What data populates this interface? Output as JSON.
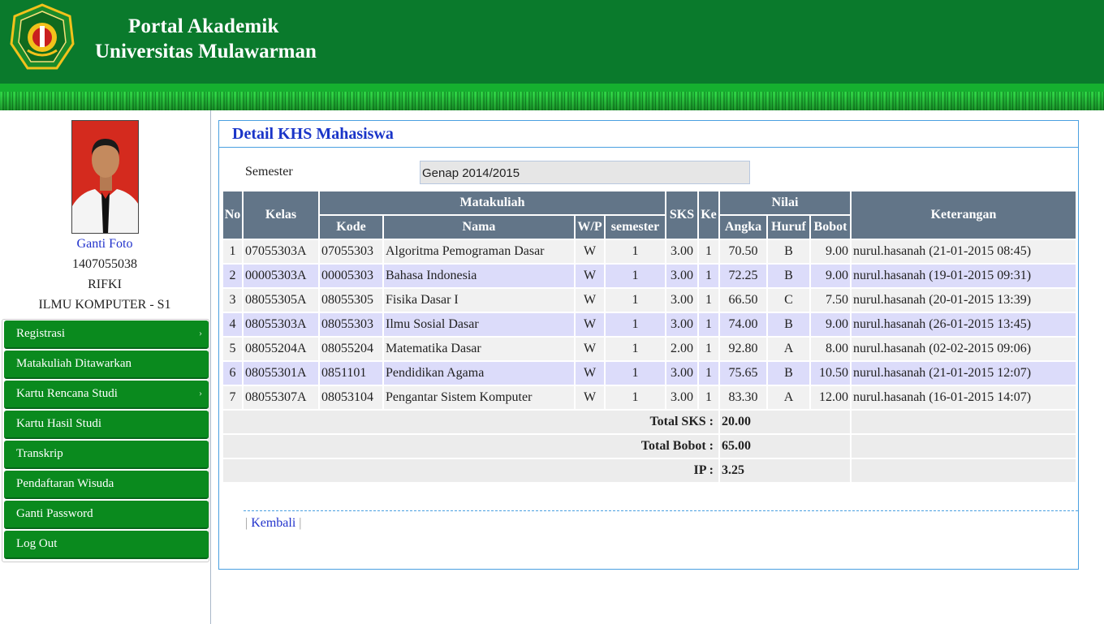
{
  "header": {
    "title_line1": "Portal Akademik",
    "title_line2": "Universitas Mulawarman"
  },
  "profile": {
    "change_photo_link": "Ganti Foto",
    "nim": "1407055038",
    "name": "RIFKI",
    "program": "ILMU KOMPUTER - S1"
  },
  "menu": [
    {
      "label": "Registrasi",
      "has_submenu": true
    },
    {
      "label": "Matakuliah Ditawarkan",
      "has_submenu": false
    },
    {
      "label": "Kartu Rencana Studi",
      "has_submenu": true
    },
    {
      "label": "Kartu Hasil Studi",
      "has_submenu": false
    },
    {
      "label": "Transkrip",
      "has_submenu": false
    },
    {
      "label": "Pendaftaran Wisuda",
      "has_submenu": false
    },
    {
      "label": "Ganti Password",
      "has_submenu": false
    },
    {
      "label": "Log Out",
      "has_submenu": false
    }
  ],
  "page": {
    "title": "Detail KHS Mahasiswa",
    "semester_label": "Semester",
    "semester_value": "Genap 2014/2015"
  },
  "table": {
    "headers": {
      "no": "No",
      "kelas": "Kelas",
      "matakuliah": "Matakuliah",
      "sks": "SKS",
      "ke": "Ke",
      "nilai": "Nilai",
      "keterangan": "Keterangan",
      "kode": "Kode",
      "nama": "Nama",
      "wp": "W/P",
      "semester": "semester",
      "angka": "Angka",
      "huruf": "Huruf",
      "bobot": "Bobot"
    },
    "rows": [
      {
        "no": "1",
        "kelas": "07055303A",
        "kode": "07055303",
        "nama": "Algoritma Pemograman Dasar",
        "wp": "W",
        "semester": "1",
        "sks": "3.00",
        "ke": "1",
        "angka": "70.50",
        "huruf": "B",
        "bobot": "9.00",
        "keterangan": "nurul.hasanah (21-01-2015 08:45)"
      },
      {
        "no": "2",
        "kelas": "00005303A",
        "kode": "00005303",
        "nama": "Bahasa Indonesia",
        "wp": "W",
        "semester": "1",
        "sks": "3.00",
        "ke": "1",
        "angka": "72.25",
        "huruf": "B",
        "bobot": "9.00",
        "keterangan": "nurul.hasanah (19-01-2015 09:31)"
      },
      {
        "no": "3",
        "kelas": "08055305A",
        "kode": "08055305",
        "nama": "Fisika Dasar I",
        "wp": "W",
        "semester": "1",
        "sks": "3.00",
        "ke": "1",
        "angka": "66.50",
        "huruf": "C",
        "bobot": "7.50",
        "keterangan": "nurul.hasanah (20-01-2015 13:39)"
      },
      {
        "no": "4",
        "kelas": "08055303A",
        "kode": "08055303",
        "nama": "Ilmu Sosial Dasar",
        "wp": "W",
        "semester": "1",
        "sks": "3.00",
        "ke": "1",
        "angka": "74.00",
        "huruf": "B",
        "bobot": "9.00",
        "keterangan": "nurul.hasanah (26-01-2015 13:45)"
      },
      {
        "no": "5",
        "kelas": "08055204A",
        "kode": "08055204",
        "nama": "Matematika Dasar",
        "wp": "W",
        "semester": "1",
        "sks": "2.00",
        "ke": "1",
        "angka": "92.80",
        "huruf": "A",
        "bobot": "8.00",
        "keterangan": "nurul.hasanah (02-02-2015 09:06)"
      },
      {
        "no": "6",
        "kelas": "08055301A",
        "kode": "0851101",
        "nama": "Pendidikan Agama",
        "wp": "W",
        "semester": "1",
        "sks": "3.00",
        "ke": "1",
        "angka": "75.65",
        "huruf": "B",
        "bobot": "10.50",
        "keterangan": "nurul.hasanah (21-01-2015 12:07)"
      },
      {
        "no": "7",
        "kelas": "08055307A",
        "kode": "08053104",
        "nama": "Pengantar Sistem Komputer",
        "wp": "W",
        "semester": "1",
        "sks": "3.00",
        "ke": "1",
        "angka": "83.30",
        "huruf": "A",
        "bobot": "12.00",
        "keterangan": "nurul.hasanah (16-01-2015 14:07)"
      }
    ],
    "summary": {
      "total_sks_label": "Total SKS :",
      "total_sks": "20.00",
      "total_bobot_label": "Total Bobot :",
      "total_bobot": "65.00",
      "ip_label": "IP :",
      "ip": "3.25"
    }
  },
  "footer_links": {
    "back": "Kembali",
    "sep": "|"
  },
  "colors": {
    "header_green": "#0a7a2c",
    "menu_green": "#0a8a1e",
    "table_header": "#627588",
    "row_highlight": "#dcdcfa",
    "title_blue": "#1a35c8"
  }
}
